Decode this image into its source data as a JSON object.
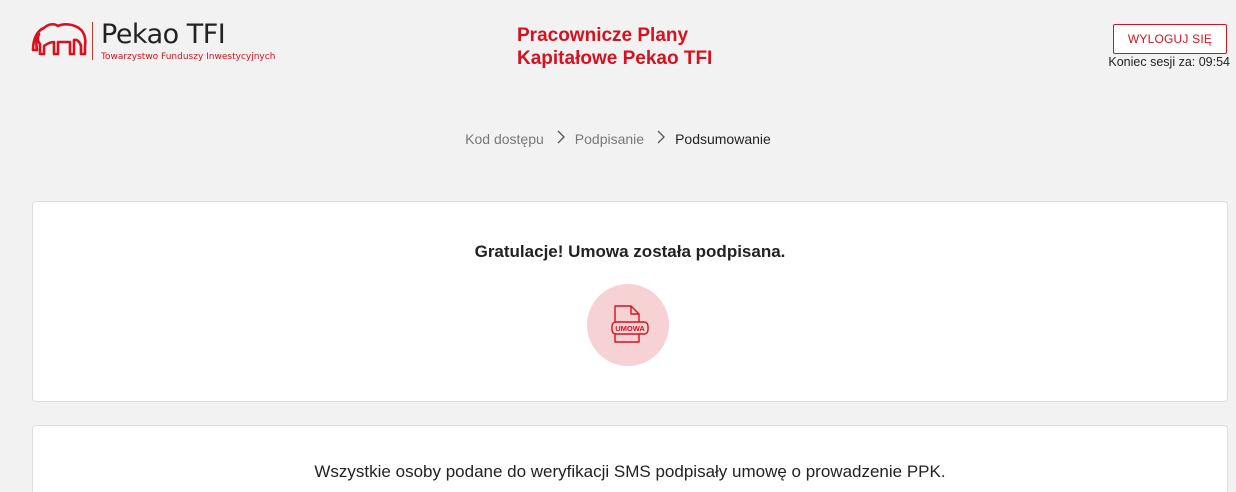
{
  "header": {
    "logo": {
      "name": "Pekao TFI",
      "subtitle": "Towarzystwo Funduszy Inwestycyjnych"
    },
    "title_line1": "Pracownicze Plany",
    "title_line2": "Kapitałowe Pekao TFI",
    "logout_label": "WYLOGUJ SIĘ",
    "session_text": "Koniec sesji za: 09:54"
  },
  "breadcrumb": {
    "steps": [
      "Kod dostępu",
      "Podpisanie",
      "Podsumowanie"
    ],
    "separator_icon": "chevron-right-icon",
    "active_step": "Podsumowanie"
  },
  "success_card": {
    "title": "Gratulacje! Umowa została podpisana.",
    "icon": "document-umowa-icon",
    "icon_label": "UMOWA"
  },
  "info_card": {
    "text": "Wszystkie osoby podane do weryfikacji SMS podpisały umowę o prowadzenie PPK."
  },
  "colors": {
    "brand_red": "#d5121f",
    "icon_circle": "#f7d2d4",
    "page_background": "#f2f2f2",
    "card_background": "#ffffff"
  }
}
